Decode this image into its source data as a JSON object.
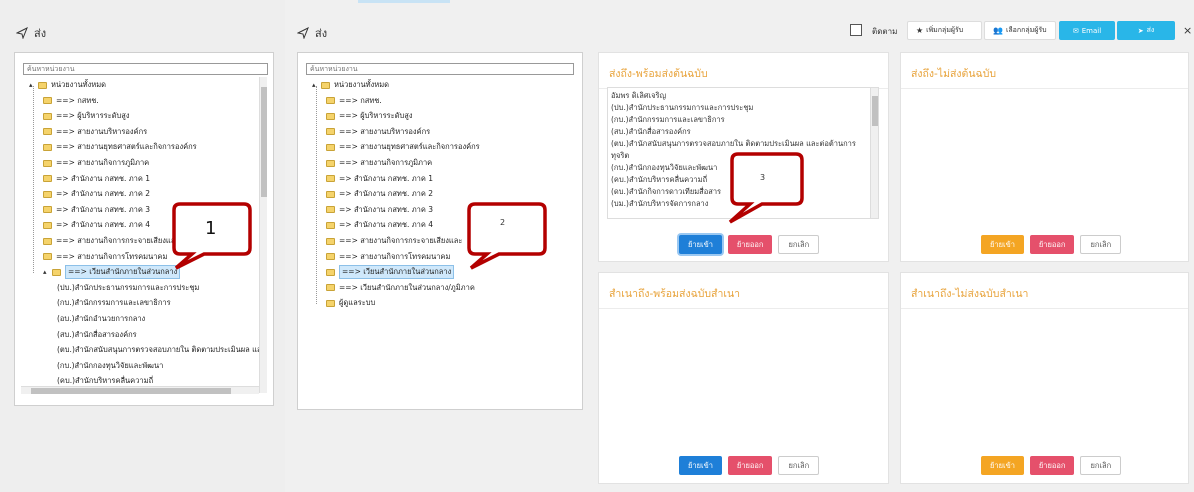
{
  "left_panel": {
    "title": "ส่ง",
    "search_placeholder": "ค้นหาหน่วยงาน",
    "tree": [
      "หน่วยงานทั้งหมด",
      "==> กสทช.",
      "==> ผู้บริหารระดับสูง",
      "==> สายงานบริหารองค์กร",
      "==> สายงานยุทธศาสตร์และกิจการองค์กร",
      "==> สายงานกิจการภูมิภาค",
      "=> สำนักงาน กสทช. ภาค 1",
      "=> สำนักงาน กสทช. ภาค 2",
      "=> สำนักงาน กสทช. ภาค 3",
      "=> สำนักงาน กสทช. ภาค 4",
      "==> สายงานกิจการกระจายเสียงและ",
      "==> สายงานกิจการโทรคมนาคม",
      "==> เวียนสำนักภายในส่วนกลาง",
      "(ปบ.)สำนักประธานกรรมการและการประชุม",
      "(กบ.)สำนักกรรมการและเลขาธิการ",
      "(อบ.)สำนักอำนวยการกลาง",
      "(สบ.)สำนักสื่อสารองค์กร",
      "(ตบ.)สำนักสนับสนุนการตรวจสอบภายใน ติดตามประเมินผล และ",
      "(กบ.)สำนักกองทุนวิจัยและพัฒนา",
      "(คบ.)สำนักบริหารคลื่นความถี่"
    ],
    "callout": "1"
  },
  "main": {
    "title": "ส่ง",
    "follow_label": "ติดตาม",
    "buttons": {
      "add_group": "เพิ่มกลุ่มผู้รับ",
      "select_group": "เลือกกลุ่มผู้รับ",
      "email": "Email",
      "send": "ส่ง",
      "close": "×"
    },
    "search_placeholder": "ค้นหาหน่วยงาน",
    "tree": [
      "หน่วยงานทั้งหมด",
      "==> กสทช.",
      "==> ผู้บริหารระดับสูง",
      "==> สายงานบริหารองค์กร",
      "==> สายงานยุทธศาสตร์และกิจการองค์กร",
      "==> สายงานกิจการภูมิภาค",
      "=> สำนักงาน กสทช. ภาค 1",
      "=> สำนักงาน กสทช. ภาค 2",
      "=> สำนักงาน กสทช. ภาค 3",
      "=> สำนักงาน กสทช. ภาค 4",
      "==> สายงานกิจการกระจายเสียงและ",
      "==> สายงานกิจการโทรคมนาคม",
      "==> เวียนสำนักภายในส่วนกลาง",
      "==> เวียนสำนักภายในส่วนกลาง/ภูมิภาค",
      "ผู้ดูแลระบบ"
    ],
    "callout_tree": "2",
    "callout_card": "3",
    "cards": [
      {
        "title": "ส่งถึง-พร้อมส่งต้นฉบับ",
        "items": [
          "อัมพร ดิเลิศเจริญ",
          "(ปบ.)สำนักประธานกรรมการและการประชุม",
          "(กบ.)สำนักกรรมการและเลขาธิการ",
          "(สบ.)สำนักสื่อสารองค์กร",
          "(ตบ.)สำนักสนับสนุนการตรวจสอบภายใน ติดตามประเมินผล และต่อต้านการ",
          "ทุจริต",
          "(กบ.)สำนักกองทุนวิจัยและพัฒนา",
          "(คบ.)สำนักบริหารคลื่นความถี่",
          "(ดบ.)สำนักกิจการดาวเทียมสื่อสาร",
          "(บม.)สำนักบริหารจัดการกลาง"
        ],
        "btn_in": "ย้ายเข้า",
        "btn_out": "ย้ายออก",
        "btn_cancel": "ยกเลิก"
      },
      {
        "title": "ส่งถึง-ไม่ส่งต้นฉบับ",
        "btn_in": "ย้ายเข้า",
        "btn_out": "ย้ายออก",
        "btn_cancel": "ยกเลิก"
      },
      {
        "title": "สำเนาถึง-พร้อมส่งฉบับสำเนา",
        "btn_in": "ย้ายเข้า",
        "btn_out": "ย้ายออก",
        "btn_cancel": "ยกเลิก"
      },
      {
        "title": "สำเนาถึง-ไม่ส่งฉบับสำเนา",
        "btn_in": "ย้ายเข้า",
        "btn_out": "ย้ายออก",
        "btn_cancel": "ยกเลิก"
      }
    ]
  },
  "colors": {
    "card_title": "#e8a33b",
    "btn_blue": "#1e7fd8",
    "btn_red": "#e5506b",
    "btn_orange": "#f4a523",
    "btn_cyan": "#29b6e8",
    "callout_stroke": "#b30000",
    "selected_node": "#cfe8fb"
  },
  "icons": [
    "send-icon",
    "folder-icon",
    "star-icon",
    "users-icon",
    "envelope-icon",
    "close-icon"
  ]
}
